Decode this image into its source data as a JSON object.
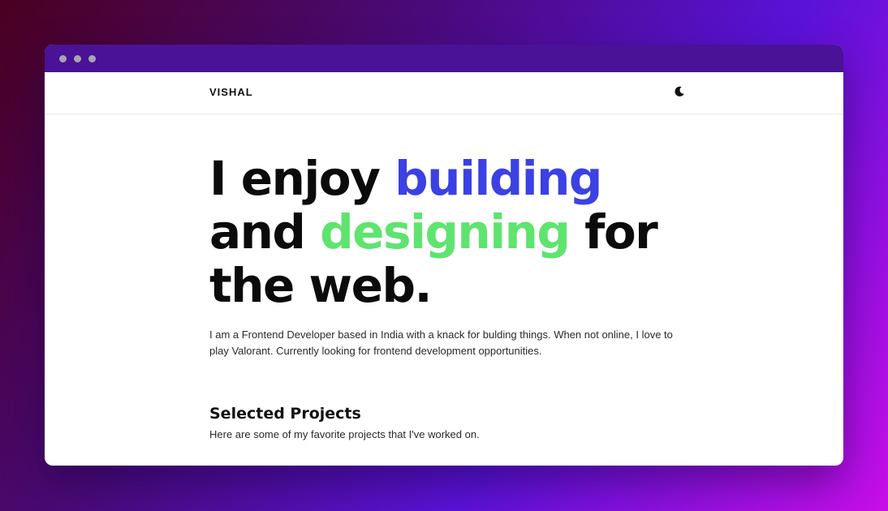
{
  "window": {
    "titlebar_colors": [
      "#ff5f57",
      "#febc2e",
      "#28c840"
    ]
  },
  "nav": {
    "brand": "VISHAL",
    "theme_toggle_icon": "moon-icon"
  },
  "hero": {
    "line1_start": "I enjoy ",
    "line1_highlight": "building",
    "line2_start": "and ",
    "line2_highlight": "designing",
    "line2_end": " for",
    "line3": "the web.",
    "highlight_colors": {
      "building": "#3b41e3",
      "designing": "#5ee46f"
    },
    "intro": "I am a Frontend Developer based in India with a knack for bulding things. When not online, I love to play Valorant. Currently looking for frontend development opportunities."
  },
  "projects": {
    "title": "Selected Projects",
    "subtitle": "Here are some of my favorite projects that I've worked on."
  }
}
